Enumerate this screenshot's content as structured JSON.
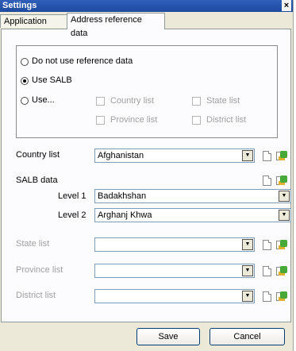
{
  "window": {
    "title": "Settings",
    "close": "×"
  },
  "tabs": [
    {
      "label": "Application",
      "active": false
    },
    {
      "label": "Address reference data",
      "active": true
    }
  ],
  "reference_mode": {
    "options": [
      {
        "label": "Do not use reference data",
        "checked": false
      },
      {
        "label": "Use SALB",
        "checked": true
      },
      {
        "label": "Use...",
        "checked": false
      }
    ],
    "checkboxes": [
      {
        "label": "Country list",
        "checked": false
      },
      {
        "label": "State list",
        "checked": false
      },
      {
        "label": "Province list",
        "checked": false
      },
      {
        "label": "District list",
        "checked": false
      }
    ]
  },
  "country": {
    "label": "Country list",
    "value": "Afghanistan"
  },
  "salb": {
    "label": "SALB data",
    "level1": {
      "label": "Level 1",
      "value": "Badakhshan"
    },
    "level2": {
      "label": "Level 2",
      "value": "Arghanj Khwa"
    }
  },
  "state": {
    "label": "State list",
    "value": ""
  },
  "province": {
    "label": "Province list",
    "value": ""
  },
  "district": {
    "label": "District list",
    "value": ""
  },
  "footer": {
    "save_label": "Save",
    "cancel_label": "Cancel"
  },
  "icons": {
    "combo_arrow": "▼",
    "new": "new-document-icon",
    "open": "open-file-icon"
  }
}
